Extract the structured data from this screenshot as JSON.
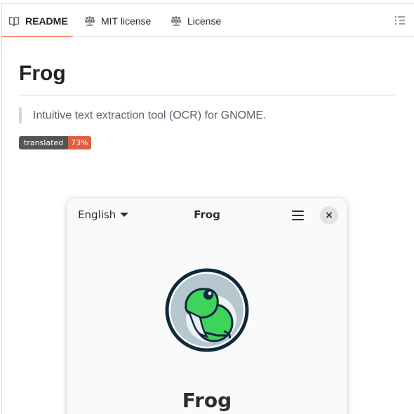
{
  "tabs": [
    {
      "label": "README",
      "icon": "book-icon",
      "active": true
    },
    {
      "label": "MIT license",
      "icon": "scale-icon"
    },
    {
      "label": "License",
      "icon": "scale-icon"
    }
  ],
  "readme": {
    "title": "Frog",
    "description": "Intuitive text extraction tool (OCR) for GNOME.",
    "badge": {
      "label": "translated",
      "value": "73%",
      "label_color": "#555555",
      "value_color": "#e05d44"
    }
  },
  "app_window": {
    "language": "English",
    "title": "Frog",
    "close_symbol": "×",
    "app_name": "Frog"
  },
  "colors": {
    "active_tab_underline": "#fd8c73"
  }
}
